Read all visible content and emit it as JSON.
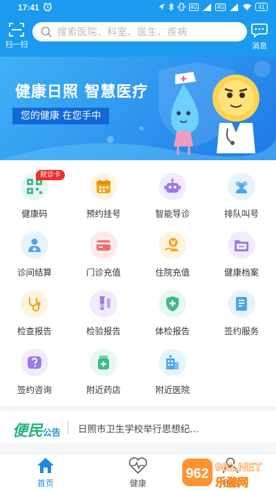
{
  "status_bar": {
    "time": "17:41",
    "network_tag_1": "4G",
    "network_tag_2": "4G",
    "battery": "41"
  },
  "header": {
    "scan_label": "扫一扫",
    "search_placeholder": "搜索医院、科室、医生、疾病",
    "message_label": "消息"
  },
  "banner": {
    "headline": "健康日照 智慧医疗",
    "slogan": "您的健康 在您手中"
  },
  "services": [
    {
      "label": "健康码",
      "icon": "qr-code-icon",
      "color": "#3dbb8a",
      "bg": "#e8f7ef",
      "badge": "就诊卡"
    },
    {
      "label": "预约挂号",
      "icon": "calendar-icon",
      "color": "#f4a51c",
      "bg": "#fdf4e0"
    },
    {
      "label": "智能导诊",
      "icon": "robot-icon",
      "color": "#9b7be8",
      "bg": "#f1ecfc"
    },
    {
      "label": "排队叫号",
      "icon": "queue-icon",
      "color": "#4aa6f0",
      "bg": "#e7f3fd"
    },
    {
      "label": "诊间结算",
      "icon": "doctor-icon",
      "color": "#4aa6f0",
      "bg": "#e7f3fd"
    },
    {
      "label": "门诊充值",
      "icon": "card-icon",
      "color": "#f26b6b",
      "bg": "#fdeaea"
    },
    {
      "label": "住院充值",
      "icon": "yen-hand-icon",
      "color": "#f4a51c",
      "bg": "#fdf4e0"
    },
    {
      "label": "健康档案",
      "icon": "folder-icon",
      "color": "#9b7be8",
      "bg": "#f1ecfc"
    },
    {
      "label": "检查报告",
      "icon": "stethoscope-icon",
      "color": "#f4a51c",
      "bg": "#fdf4e0"
    },
    {
      "label": "检验报告",
      "icon": "test-tube-icon",
      "color": "#9b7be8",
      "bg": "#f1ecfc"
    },
    {
      "label": "体检报告",
      "icon": "shield-plus-icon",
      "color": "#3dbb8a",
      "bg": "#e8f7ef"
    },
    {
      "label": "签约服务",
      "icon": "document-icon",
      "color": "#4aa6f0",
      "bg": "#e7f3fd"
    },
    {
      "label": "签约咨询",
      "icon": "question-icon",
      "color": "#9b7be8",
      "bg": "#f1ecfc"
    },
    {
      "label": "附近药店",
      "icon": "medicine-icon",
      "color": "#3dbb8a",
      "bg": "#e8f7ef"
    },
    {
      "label": "附近医院",
      "icon": "hospital-icon",
      "color": "#4aa6f0",
      "bg": "#e7f3fd"
    }
  ],
  "notice": {
    "logo_big": "便民",
    "logo_small": "公告",
    "text": "日照市卫生学校举行思想纪..."
  },
  "tabbar": {
    "tabs": [
      {
        "label": "首页",
        "active": true
      },
      {
        "label": "健康",
        "active": false
      },
      {
        "label": "我的",
        "active": false
      }
    ]
  },
  "watermark": {
    "line1": "962.NET",
    "line2": "乐游网"
  },
  "colors": {
    "brand_blue": "#1a9bf0",
    "active_tab": "#1a89e6",
    "badge_red": "#ef2e2e"
  }
}
